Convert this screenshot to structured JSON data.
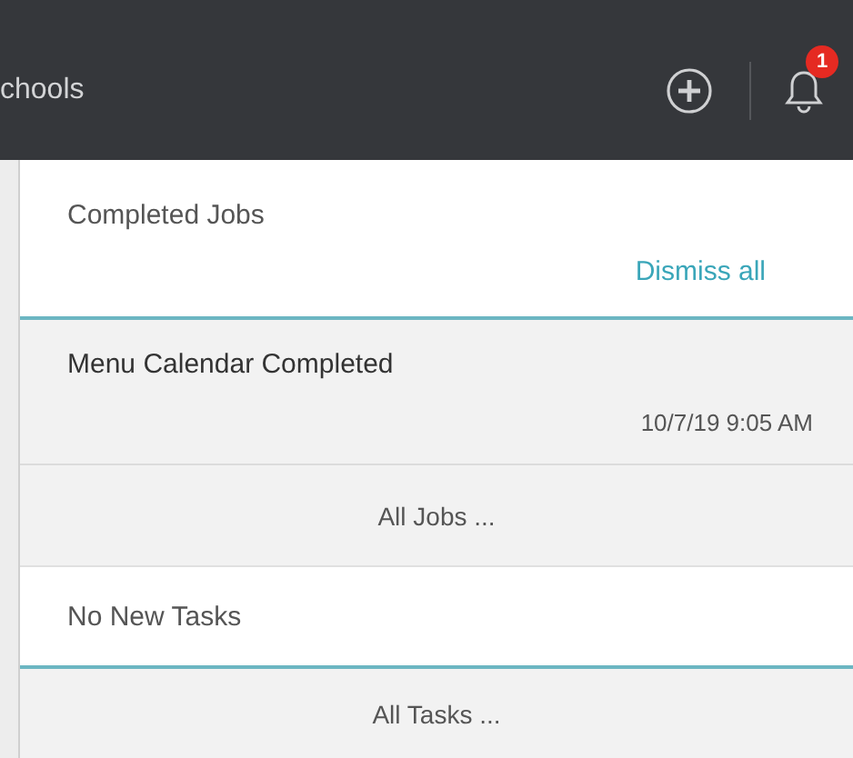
{
  "topbar": {
    "title": "chools",
    "notification_count": "1"
  },
  "jobs": {
    "heading": "Completed Jobs",
    "dismiss": "Dismiss all",
    "items": [
      {
        "title": "Menu Calendar Completed",
        "time": "10/7/19 9:05 AM"
      }
    ],
    "footer": "All Jobs ..."
  },
  "tasks": {
    "heading": "No New Tasks",
    "footer": "All Tasks ..."
  }
}
